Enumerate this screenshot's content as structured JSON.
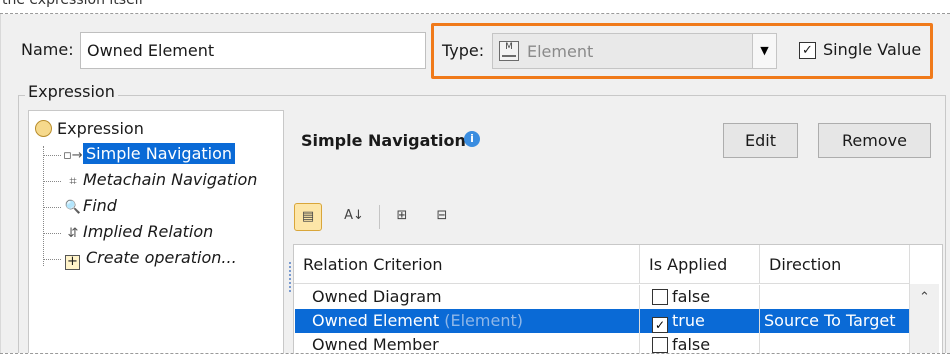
{
  "clipped_top_text": "the expression itself",
  "name": {
    "label": "Name:",
    "value": "Owned Element"
  },
  "type": {
    "label": "Type:",
    "value": "Element",
    "icon": "element-icon"
  },
  "single_value": {
    "label": "Single Value",
    "checked": true
  },
  "expression_group": {
    "label": "Expression"
  },
  "tree": {
    "root": "Expression",
    "items": [
      {
        "label": "Simple Navigation",
        "icon": "navigation-icon",
        "selected": true,
        "italic": false
      },
      {
        "label": "Metachain Navigation",
        "icon": "metachain-icon",
        "selected": false,
        "italic": true
      },
      {
        "label": "Find",
        "icon": "search-icon",
        "selected": false,
        "italic": true
      },
      {
        "label": "Implied Relation",
        "icon": "relation-icon",
        "selected": false,
        "italic": true
      },
      {
        "label": "Create operation...",
        "icon": "plus-icon",
        "selected": false,
        "italic": true
      }
    ]
  },
  "panel": {
    "title": "Simple Navigation",
    "edit": "Edit",
    "remove": "Remove"
  },
  "table": {
    "headers": [
      "Relation Criterion",
      "Is Applied",
      "Direction"
    ],
    "rows": [
      {
        "criterion": "Owned Diagram",
        "type_hint": "",
        "applied": "false",
        "checked": false,
        "direction": ""
      },
      {
        "criterion": "Owned Element",
        "type_hint": "(Element)",
        "applied": "true",
        "checked": true,
        "direction": "Source To Target",
        "selected": true
      },
      {
        "criterion": "Owned Member",
        "type_hint": "",
        "applied": "false",
        "checked": false,
        "direction": ""
      }
    ]
  },
  "colors": {
    "highlight": "#f07a1a",
    "selection": "#0a6ad6"
  }
}
